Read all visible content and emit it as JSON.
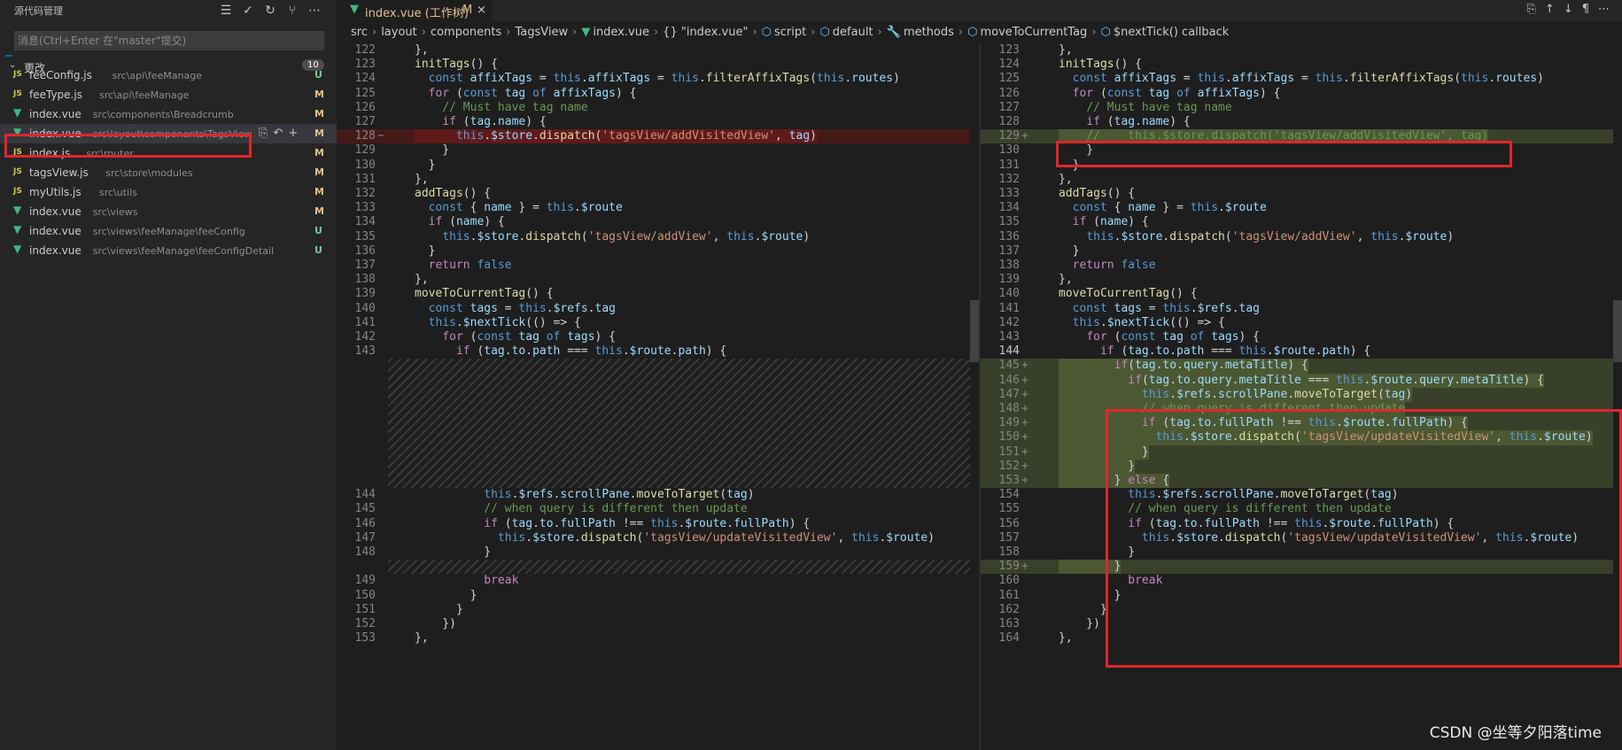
{
  "sidebar": {
    "title": "源代码管理",
    "actions": [
      "tree-icon",
      "check-icon",
      "refresh-icon",
      "branch-icon",
      "more-icon"
    ],
    "commit_placeholder": "消息(Ctrl+Enter 在\"master\"提交)",
    "changes_label": "更改",
    "changes_count": "10",
    "files": [
      {
        "icon": "JS",
        "name": "feeConfig.js",
        "path": "src\\api\\feeManage",
        "status": "U"
      },
      {
        "icon": "JS",
        "name": "feeType.js",
        "path": "src\\api\\feeManage",
        "status": "M"
      },
      {
        "icon": "vue",
        "name": "index.vue",
        "path": "src\\components\\Breadcrumb",
        "status": "M"
      },
      {
        "icon": "vue",
        "name": "index.vue",
        "path": "src\\layout\\components\\TagsView",
        "status": "M",
        "selected": true
      },
      {
        "icon": "JS",
        "name": "index.js",
        "path": "src\\router",
        "status": "M"
      },
      {
        "icon": "JS",
        "name": "tagsView.js",
        "path": "src\\store\\modules",
        "status": "M"
      },
      {
        "icon": "JS",
        "name": "myUtils.js",
        "path": "src\\utils",
        "status": "M"
      },
      {
        "icon": "vue",
        "name": "index.vue",
        "path": "src\\views",
        "status": "M"
      },
      {
        "icon": "vue",
        "name": "index.vue",
        "path": "src\\views\\feeManage\\feeConfig",
        "status": "U"
      },
      {
        "icon": "vue",
        "name": "index.vue",
        "path": "src\\views\\feeManage\\feeConfigDetail",
        "status": "U"
      }
    ]
  },
  "tab": {
    "title": "index.vue (工作树)",
    "modified": "M",
    "close": "×"
  },
  "breadcrumb": [
    "src",
    "layout",
    "components",
    "TagsView",
    "index.vue",
    "{} \"index.vue\"",
    "script",
    "default",
    "methods",
    "moveToCurrentTag",
    "$nextTick() callback"
  ],
  "left_lines": [
    {
      "n": "122",
      "t": "      },"
    },
    {
      "n": "123",
      "t": "      initTags() {"
    },
    {
      "n": "124",
      "t": "        const affixTags = this.affixTags = this.filterAffixTags(this.routes)"
    },
    {
      "n": "125",
      "t": "        for (const tag of affixTags) {"
    },
    {
      "n": "126",
      "t": "          // Must have tag name"
    },
    {
      "n": "127",
      "t": "          if (tag.name) {"
    },
    {
      "n": "128",
      "t": "            this.$store.dispatch('tagsView/addVisitedView', tag)",
      "m": "−",
      "kind": "del"
    },
    {
      "n": "129",
      "t": "          }"
    },
    {
      "n": "130",
      "t": "        }"
    },
    {
      "n": "131",
      "t": "      },"
    },
    {
      "n": "132",
      "t": "      addTags() {"
    },
    {
      "n": "133",
      "t": "        const { name } = this.$route"
    },
    {
      "n": "134",
      "t": "        if (name) {"
    },
    {
      "n": "135",
      "t": "          this.$store.dispatch('tagsView/addView', this.$route)"
    },
    {
      "n": "136",
      "t": "        }"
    },
    {
      "n": "137",
      "t": "        return false"
    },
    {
      "n": "138",
      "t": "      },"
    },
    {
      "n": "139",
      "t": "      moveToCurrentTag() {"
    },
    {
      "n": "140",
      "t": "        const tags = this.$refs.tag"
    },
    {
      "n": "141",
      "t": "        this.$nextTick(() => {"
    },
    {
      "n": "142",
      "t": "          for (const tag of tags) {"
    },
    {
      "n": "143",
      "t": "            if (tag.to.path === this.$route.path) {"
    },
    {
      "n": "144",
      "t": "                this.$refs.scrollPane.moveToTarget(tag)",
      "gap": 9
    },
    {
      "n": "145",
      "t": "                // when query is different then update"
    },
    {
      "n": "146",
      "t": "                if (tag.to.fullPath !== this.$route.fullPath) {"
    },
    {
      "n": "147",
      "t": "                  this.$store.dispatch('tagsView/updateVisitedView', this.$route)"
    },
    {
      "n": "148",
      "t": "                }"
    },
    {
      "n": "149",
      "t": "                break",
      "gap": 1
    },
    {
      "n": "150",
      "t": "              }"
    },
    {
      "n": "151",
      "t": "            }"
    },
    {
      "n": "152",
      "t": "          })"
    },
    {
      "n": "153",
      "t": "      },"
    }
  ],
  "right_lines": [
    {
      "n": "123",
      "t": "      },"
    },
    {
      "n": "124",
      "t": "      initTags() {"
    },
    {
      "n": "125",
      "t": "        const affixTags = this.affixTags = this.filterAffixTags(this.routes)"
    },
    {
      "n": "126",
      "t": "        for (const tag of affixTags) {"
    },
    {
      "n": "127",
      "t": "          // Must have tag name"
    },
    {
      "n": "128",
      "t": "          if (tag.name) {"
    },
    {
      "n": "129",
      "t": "          //    this.$store.dispatch('tagsView/addVisitedView', tag)",
      "m": "+",
      "kind": "add"
    },
    {
      "n": "130",
      "t": "          }"
    },
    {
      "n": "131",
      "t": "        }"
    },
    {
      "n": "132",
      "t": "      },"
    },
    {
      "n": "133",
      "t": "      addTags() {"
    },
    {
      "n": "134",
      "t": "        const { name } = this.$route"
    },
    {
      "n": "135",
      "t": "        if (name) {"
    },
    {
      "n": "136",
      "t": "          this.$store.dispatch('tagsView/addView', this.$route)"
    },
    {
      "n": "137",
      "t": "        }"
    },
    {
      "n": "138",
      "t": "        return false"
    },
    {
      "n": "139",
      "t": "      },"
    },
    {
      "n": "140",
      "t": "      moveToCurrentTag() {"
    },
    {
      "n": "141",
      "t": "        const tags = this.$refs.tag"
    },
    {
      "n": "142",
      "t": "        this.$nextTick(() => {"
    },
    {
      "n": "143",
      "t": "          for (const tag of tags) {"
    },
    {
      "n": "144",
      "t": "            if (tag.to.path === this.$route.path) {",
      "cur": true
    },
    {
      "n": "145",
      "t": "              if(tag.to.query.metaTitle) {",
      "m": "+",
      "kind": "add"
    },
    {
      "n": "146",
      "t": "                if(tag.to.query.metaTitle === this.$route.query.metaTitle) {",
      "m": "+",
      "kind": "add"
    },
    {
      "n": "147",
      "t": "                  this.$refs.scrollPane.moveToTarget(tag)",
      "m": "+",
      "kind": "add"
    },
    {
      "n": "148",
      "t": "                  // when query is different then update",
      "m": "+",
      "kind": "add"
    },
    {
      "n": "149",
      "t": "                  if (tag.to.fullPath !== this.$route.fullPath) {",
      "m": "+",
      "kind": "add"
    },
    {
      "n": "150",
      "t": "                    this.$store.dispatch('tagsView/updateVisitedView', this.$route)",
      "m": "+",
      "kind": "add"
    },
    {
      "n": "151",
      "t": "                  }",
      "m": "+",
      "kind": "add"
    },
    {
      "n": "152",
      "t": "                }",
      "m": "+",
      "kind": "add"
    },
    {
      "n": "153",
      "t": "              } else {",
      "m": "+",
      "kind": "add"
    },
    {
      "n": "154",
      "t": "                this.$refs.scrollPane.moveToTarget(tag)"
    },
    {
      "n": "155",
      "t": "                // when query is different then update"
    },
    {
      "n": "156",
      "t": "                if (tag.to.fullPath !== this.$route.fullPath) {"
    },
    {
      "n": "157",
      "t": "                  this.$store.dispatch('tagsView/updateVisitedView', this.$route)"
    },
    {
      "n": "158",
      "t": "                }"
    },
    {
      "n": "159",
      "t": "              }",
      "m": "+",
      "kind": "add"
    },
    {
      "n": "160",
      "t": "                break"
    },
    {
      "n": "161",
      "t": "              }"
    },
    {
      "n": "162",
      "t": "            }"
    },
    {
      "n": "163",
      "t": "          })"
    },
    {
      "n": "164",
      "t": "      },"
    }
  ],
  "watermark": "CSDN @坐等夕阳落time"
}
